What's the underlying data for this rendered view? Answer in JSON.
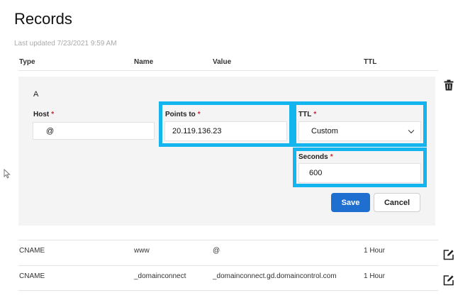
{
  "page": {
    "title": "Records",
    "last_updated": "Last updated 7/23/2021 9:59 AM"
  },
  "table": {
    "headers": [
      "Type",
      "Name",
      "Value",
      "TTL"
    ]
  },
  "edit_form": {
    "record_type": "A",
    "host": {
      "label": "Host",
      "required_mark": "*",
      "value": "@"
    },
    "points_to": {
      "label": "Points to",
      "required_mark": "*",
      "value": "20.119.136.23"
    },
    "ttl": {
      "label": "TTL",
      "required_mark": "*",
      "selected": "Custom"
    },
    "seconds": {
      "label": "Seconds",
      "required_mark": "*",
      "value": "600"
    },
    "save_label": "Save",
    "cancel_label": "Cancel",
    "highlight_color": "#14b4ee",
    "save_color": "#1e6fd0"
  },
  "rows": [
    {
      "type": "CNAME",
      "name": "www",
      "value": "@",
      "ttl": "1 Hour"
    },
    {
      "type": "CNAME",
      "name": "_domainconnect",
      "value": "_domainconnect.gd.domaincontrol.com",
      "ttl": "1 Hour"
    }
  ],
  "icons": [
    "trash-icon",
    "edit-icon",
    "mouse-cursor-icon"
  ]
}
